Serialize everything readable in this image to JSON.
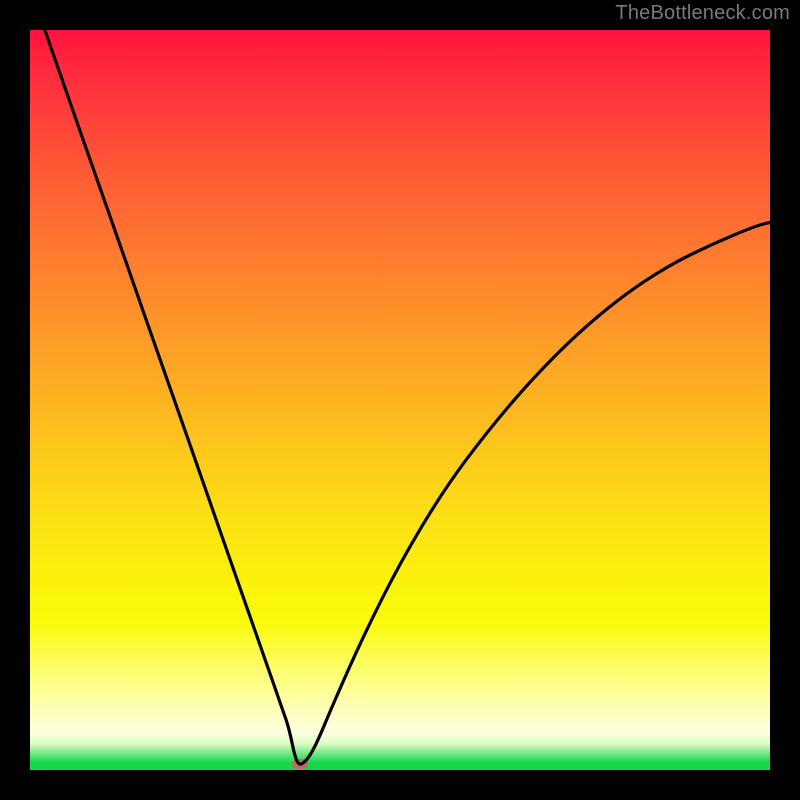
{
  "watermark": "TheBottleneck.com",
  "colors": {
    "background": "#000000",
    "curve": "#000000",
    "marker": "#C46A5A",
    "gradient_top": "#FF133F",
    "gradient_mid": "#FDC81C",
    "gradient_bottom": "#15D84B"
  },
  "chart_data": {
    "type": "line",
    "title": "",
    "xlabel": "",
    "ylabel": "",
    "xlim": [
      0,
      100
    ],
    "ylim": [
      0,
      100
    ],
    "legend": false,
    "grid": false,
    "notes": "Bottleneck-style V curve on a vertical risk gradient. The minimum (best/green zone) lies near x≈36, y≈0. No axes, ticks, or numeric labels are rendered.",
    "series": [
      {
        "name": "bottleneck-curve",
        "x": [
          2.0,
          5.0,
          8.0,
          11.0,
          14.0,
          17.0,
          20.0,
          23.0,
          26.0,
          29.0,
          32.0,
          34.0,
          35.0,
          36.0,
          37.0,
          38.5,
          41.0,
          45.0,
          50.0,
          56.0,
          62.0,
          68.0,
          74.0,
          80.0,
          86.0,
          92.0,
          98.0,
          100.0
        ],
        "y": [
          100.0,
          91.4,
          82.8,
          74.3,
          65.7,
          57.1,
          48.6,
          40.0,
          31.4,
          22.8,
          14.3,
          8.5,
          5.7,
          0.8,
          0.8,
          3.0,
          9.0,
          18.0,
          28.0,
          38.0,
          46.0,
          53.0,
          59.0,
          64.0,
          68.0,
          71.0,
          73.5,
          74.0
        ]
      }
    ],
    "minimum_point": {
      "x": 36.5,
      "y": 0.8
    }
  }
}
